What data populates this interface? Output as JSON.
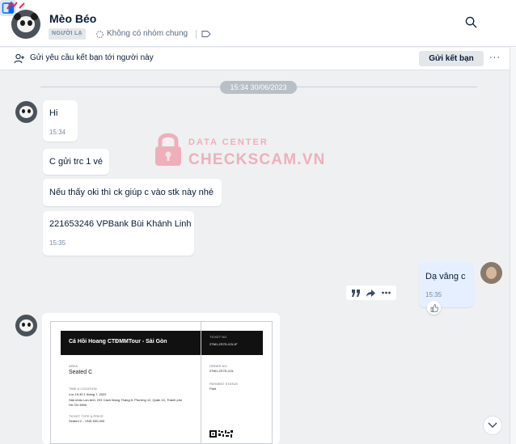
{
  "header": {
    "contact_name": "Mèo Béo",
    "stranger_badge": "NGƯỜI LẠ",
    "common_group": "Không có nhóm chung",
    "icons": [
      "search-icon",
      "sidebar-toggle-icon",
      "tag-icon",
      "group-icon"
    ]
  },
  "friend_bar": {
    "text": "Gửi yêu cầu kết bạn tới người này",
    "button_label": "Gửi kết bạn",
    "more_label": "···"
  },
  "chat": {
    "date_separator": "15:34 30/06/2023",
    "messages": [
      {
        "text": "Hi",
        "time": "15:34"
      },
      {
        "text": "C gửi trc 1 vé",
        "time": ""
      },
      {
        "text": "Nếu thấy oki thì ck giúp c vào stk này nhé",
        "time": ""
      },
      {
        "text": "221653246 VPBank Bùi Khánh Linh",
        "time": "15:35"
      }
    ],
    "my_message": {
      "text": "Dạ vâng c",
      "time": "15:35"
    }
  },
  "watermark": {
    "line1": "DATA CENTER",
    "line2": "CHECKSCAM.VN"
  },
  "ticket": {
    "title": "Cá Hồi Hoang CTĐMMTour - Sài Gòn",
    "area_label": "AREA",
    "area_value": "Seated C",
    "time_label": "TIME & LOCATION",
    "time_value": "Lúc 15:30 1 tháng 7, 2022",
    "location_line1": "Sân khấu Lan Anh, 291 Cách Mạng Tháng 8, Phường 12, Quận 10, Thành phố",
    "location_line2": "Hồ Chí Minh",
    "type_label": "TICKET TYPE & PRICE",
    "type_value": "Seated C - VND 530,000",
    "ticket_no_label": "TICKET NO.",
    "ticket_no_value": "2TM1-2S7D-X2L1F",
    "order_label": "ORDER NO.",
    "order_value": "2TM1-2S7D-X2L",
    "status_label": "PAYMENT STATUS",
    "status_value": "Paid"
  },
  "colors": {
    "accent": "#0068ff",
    "my_bubble": "#e5efff",
    "background": "#eef0f1",
    "watermark": "#f07a8e"
  }
}
